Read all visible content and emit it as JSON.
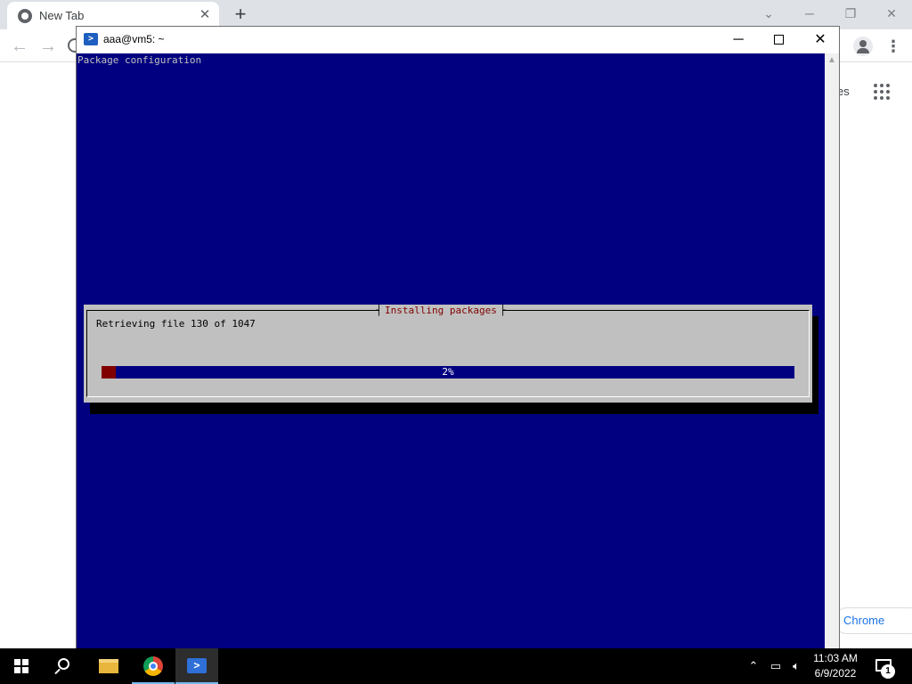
{
  "browser": {
    "tab_title": "New Tab",
    "tab_close_glyph": "✕",
    "new_tab_glyph": "+",
    "ntp_link_fragment": "es",
    "customize_label": "Chrome",
    "icons": [
      "chrome-favicon-icon",
      "back-arrow-icon",
      "forward-arrow-icon",
      "reload-icon",
      "profile-icon",
      "kebab-menu-icon",
      "apps-grid-icon"
    ]
  },
  "terminal": {
    "window_title": "aaa@vm5: ~",
    "header_text": "Package configuration",
    "dialog": {
      "title": "Installing packages",
      "message": "Retrieving file 130 of 1047",
      "progress_percent": 2,
      "progress_label": "2%"
    },
    "colors": {
      "background": "#000080",
      "dialog_bg": "#c0c0c0",
      "dialog_title": "#800000",
      "progress_fill": "#800000"
    }
  },
  "taskbar": {
    "apps": [
      "file-explorer",
      "google-chrome",
      "windows-powershell"
    ],
    "clock_time": "11:03 AM",
    "clock_date": "6/9/2022",
    "notification_count": "1"
  }
}
